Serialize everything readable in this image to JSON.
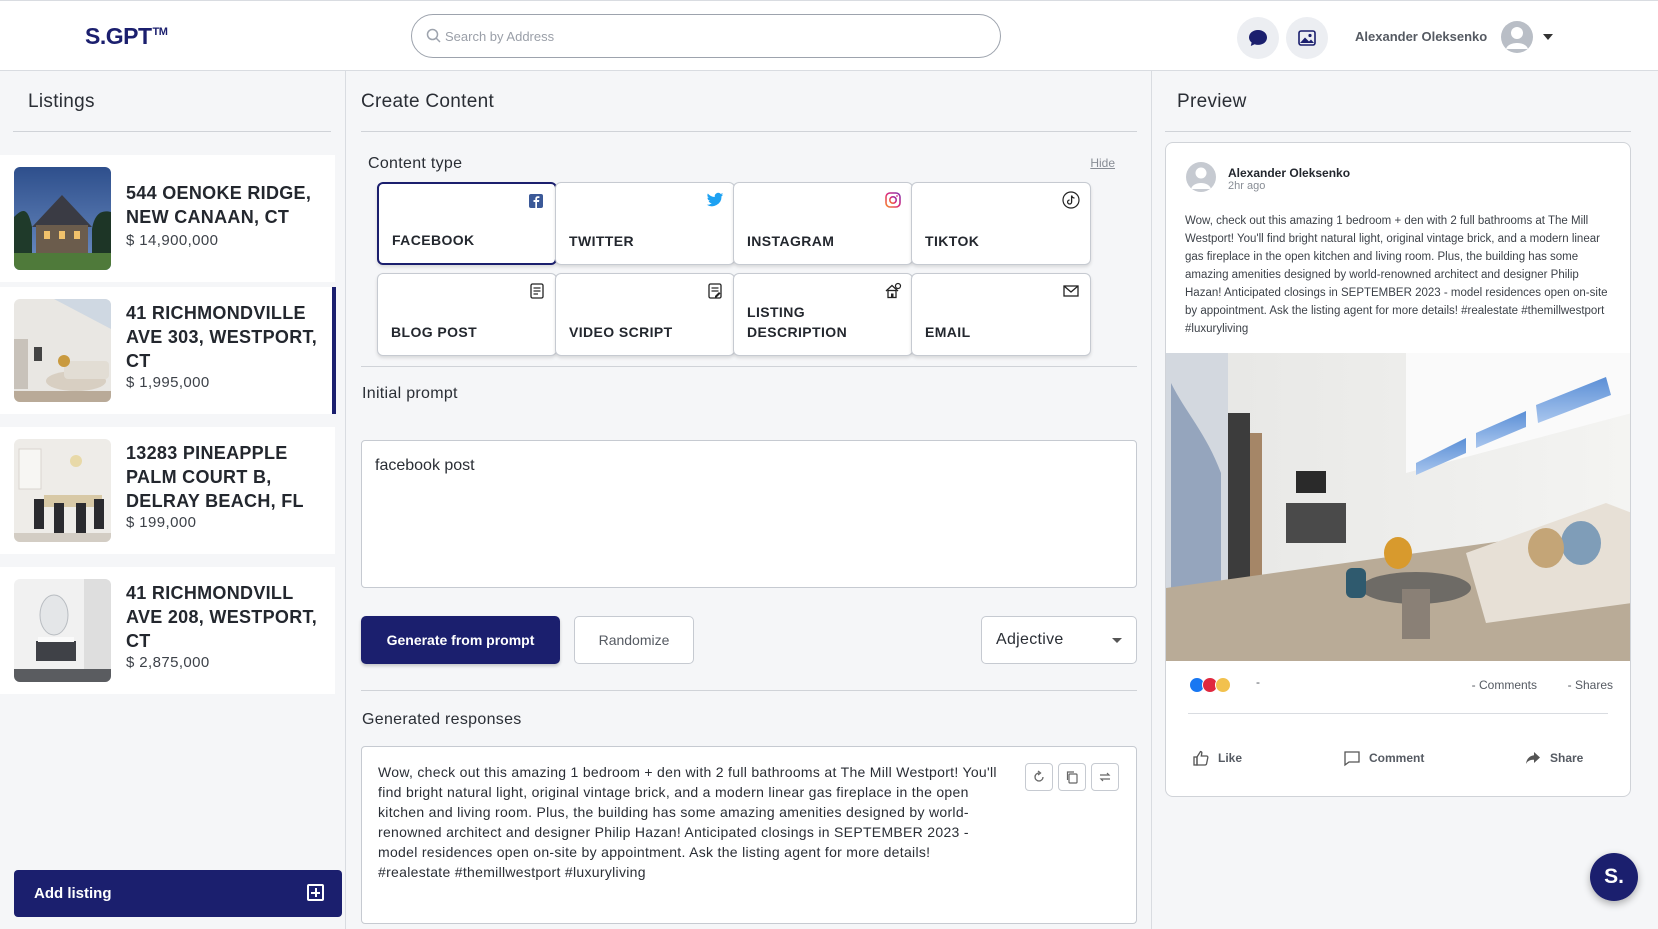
{
  "app": {
    "logo": "S.GPT",
    "logo_mark": "TM"
  },
  "search": {
    "placeholder": "Search by Address"
  },
  "header": {
    "user_name": "Alexander Oleksenko"
  },
  "listings": {
    "title": "Listings",
    "items": [
      {
        "address": "544 OENOKE RIDGE, NEW CANAAN, CT",
        "price": "$ 14,900,000"
      },
      {
        "address": "41 RICHMONDVILLE AVE 303, WESTPORT, CT",
        "price": "$ 1,995,000"
      },
      {
        "address": "13283 PINEAPPLE PALM COURT B, DELRAY BEACH, FL",
        "price": "$ 199,000"
      },
      {
        "address": "41 RICHMONDVILL AVE 208, WESTPORT, CT",
        "price": "$ 2,875,000"
      }
    ],
    "add_label": "Add listing"
  },
  "create": {
    "title": "Create Content",
    "content_type_label": "Content type",
    "hide_label": "Hide",
    "types": [
      {
        "label": "FACEBOOK",
        "icon": "facebook-icon"
      },
      {
        "label": "TWITTER",
        "icon": "twitter-icon"
      },
      {
        "label": "INSTAGRAM",
        "icon": "instagram-icon"
      },
      {
        "label": "TIKTOK",
        "icon": "tiktok-icon"
      },
      {
        "label": "BLOG POST",
        "icon": "blog-icon"
      },
      {
        "label": "VIDEO SCRIPT",
        "icon": "script-icon"
      },
      {
        "label": "LISTING DESCRIPTION",
        "icon": "house-icon"
      },
      {
        "label": "EMAIL",
        "icon": "mail-icon"
      }
    ],
    "prompt_label": "Initial prompt",
    "prompt_value": "facebook post",
    "generate_label": "Generate from prompt",
    "randomize_label": "Randomize",
    "adjective_value": "Adjective",
    "responses_label": "Generated responses",
    "response_text": "Wow, check out this amazing 1 bedroom + den with 2 full bathrooms at The Mill Westport! You'll find bright natural light, original vintage brick, and a modern linear gas fireplace in the open kitchen and living room. Plus, the building has some amazing amenities designed by world-renowned architect and designer Philip Hazan! Anticipated closings in SEPTEMBER 2023 - model residences open on-site by appointment. Ask the listing agent for more details! #realestate #themillwestport #luxuryliving"
  },
  "preview": {
    "title": "Preview",
    "author": "Alexander Oleksenko",
    "time": "2hr ago",
    "text": "Wow, check out this amazing 1 bedroom + den with 2 full bathrooms at The Mill Westport! You'll find bright natural light, original vintage brick, and a modern linear gas fireplace in the open kitchen and living room. Plus, the building has some amazing amenities designed by world-renowned architect and designer Philip Hazan! Anticipated closings in SEPTEMBER 2023 - model residences open on-site by appointment. Ask the listing agent for more details! #realestate #themillwestport #luxuryliving",
    "react_count": "-",
    "comments": "- Comments",
    "shares": "- Shares",
    "like": "Like",
    "comment": "Comment",
    "share": "Share"
  },
  "fab": {
    "label": "S."
  },
  "colors": {
    "brand": "#1b1f6e",
    "facebook": "#3b5998",
    "twitter": "#1da1f2"
  }
}
